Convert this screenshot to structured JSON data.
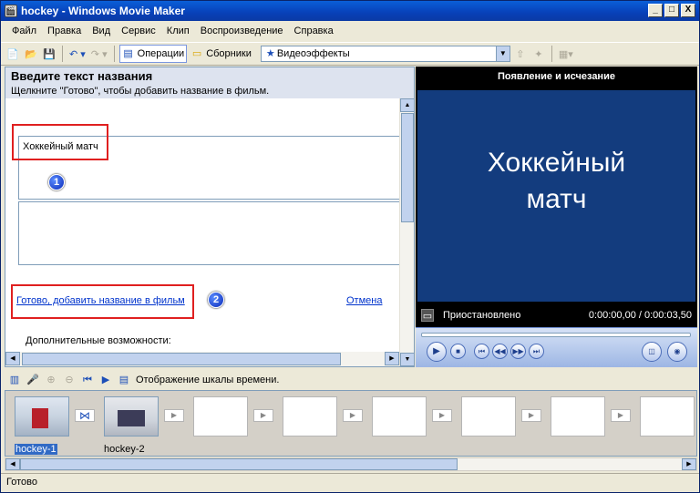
{
  "window": {
    "title": "hockey - Windows Movie Maker",
    "min": "_",
    "max": "□",
    "close": "X"
  },
  "menu": [
    "Файл",
    "Правка",
    "Вид",
    "Сервис",
    "Клип",
    "Воспроизведение",
    "Справка"
  ],
  "toolbar": {
    "operations": "Операции",
    "collections": "Сборники",
    "combo": "Видеоэффекты"
  },
  "title_task": {
    "heading": "Введите текст названия",
    "instruction": "Щелкните \"Готово\", чтобы добавить название в фильм.",
    "text": "Хоккейный матч",
    "done_link": "Готово, добавить название в фильм",
    "cancel_link": "Отмена",
    "more_options": "Дополнительные возможности:",
    "badge1": "1",
    "badge2": "2"
  },
  "preview": {
    "effect_title": "Появление и исчезание",
    "line1": "Хоккейный",
    "line2": "матч",
    "state": "Приостановлено",
    "time": "0:00:00,00 / 0:00:03,50"
  },
  "storyboard": {
    "label": "Отображение шкалы времени.",
    "clip1": "hockey-1",
    "clip2": "hockey-2"
  },
  "statusbar": {
    "text": "Готово"
  }
}
